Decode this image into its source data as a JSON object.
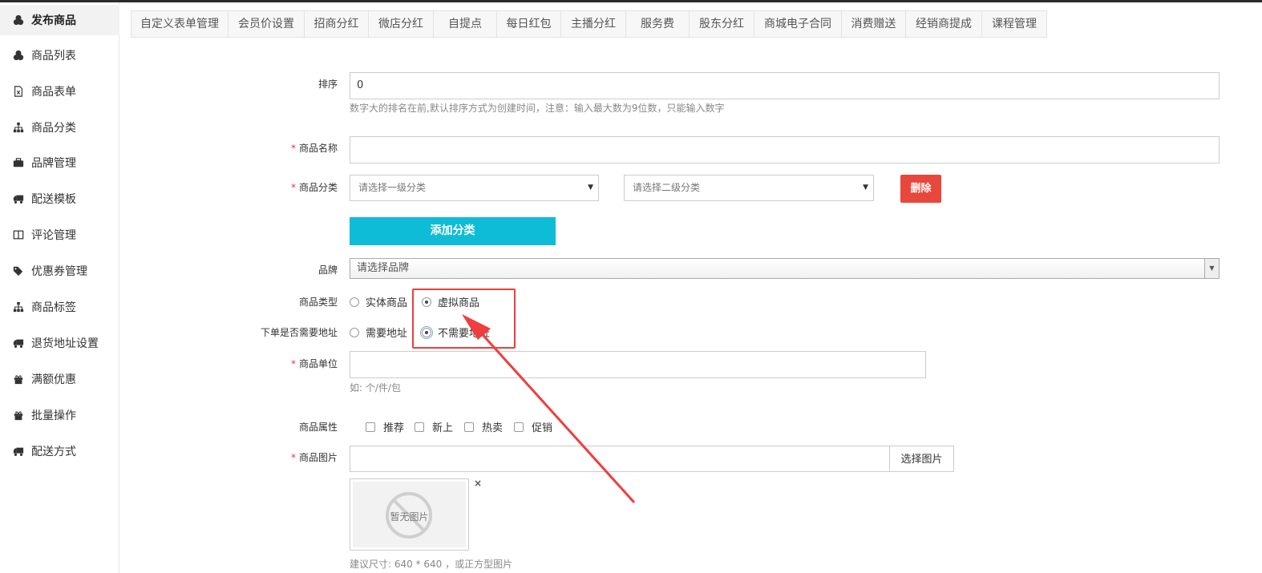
{
  "sidebar": {
    "items": [
      {
        "label": "发布商品",
        "icon": "goods-icon",
        "active": true
      },
      {
        "label": "商品列表",
        "icon": "goods-icon"
      },
      {
        "label": "商品表单",
        "icon": "excel-file-icon"
      },
      {
        "label": "商品分类",
        "icon": "sitemap-icon"
      },
      {
        "label": "品牌管理",
        "icon": "briefcase-icon"
      },
      {
        "label": "配送模板",
        "icon": "truck-icon"
      },
      {
        "label": "评论管理",
        "icon": "columns-icon"
      },
      {
        "label": "优惠券管理",
        "icon": "tags-icon"
      },
      {
        "label": "商品标签",
        "icon": "sitemap-icon"
      },
      {
        "label": "退货地址设置",
        "icon": "truck-icon"
      },
      {
        "label": "满额优惠",
        "icon": "gift-icon"
      },
      {
        "label": "批量操作",
        "icon": "gift-icon"
      },
      {
        "label": "配送方式",
        "icon": "truck-icon"
      }
    ]
  },
  "tabs": [
    "自定义表单管理",
    "会员价设置",
    "招商分红",
    "微店分红",
    "自提点",
    "每日红包",
    "主播分红",
    "服务费",
    "股东分红",
    "商城电子合同",
    "消费赠送",
    "经销商提成",
    "课程管理"
  ],
  "form": {
    "sort": {
      "label": "排序",
      "value": "0",
      "help": "数字大的排名在前,默认排序方式为创建时间，注意：输入最大数为9位数，只能输入数字"
    },
    "name": {
      "label": "商品名称",
      "required_mark": "*",
      "value": ""
    },
    "category": {
      "label": "商品分类",
      "required_mark": "*",
      "first_placeholder": "请选择一级分类",
      "second_placeholder": "请选择二级分类",
      "delete_label": "删除",
      "add_label": "添加分类"
    },
    "brand": {
      "label": "品牌",
      "placeholder": "请选择品牌"
    },
    "goods_type": {
      "label": "商品类型",
      "options": [
        "实体商品",
        "虚拟商品"
      ],
      "selected": "虚拟商品"
    },
    "need_address": {
      "label": "下单是否需要地址",
      "options": [
        "需要地址",
        "不需要地址"
      ],
      "selected": "不需要地址"
    },
    "unit": {
      "label": "商品单位",
      "required_mark": "*",
      "value": "",
      "help": "如: 个/件/包"
    },
    "attributes": {
      "label": "商品属性",
      "options": [
        "推荐",
        "新上",
        "热卖",
        "促销"
      ]
    },
    "image": {
      "label": "商品图片",
      "required_mark": "*",
      "select_label": "选择图片",
      "no_image_text": "暂无图片",
      "remove_label": "×",
      "help": "建议尺寸: 640 * 640 ，或正方型图片"
    }
  },
  "colors": {
    "danger": "#e8473b",
    "primary": "#0fbcd7",
    "annotation": "#f03d3d"
  }
}
